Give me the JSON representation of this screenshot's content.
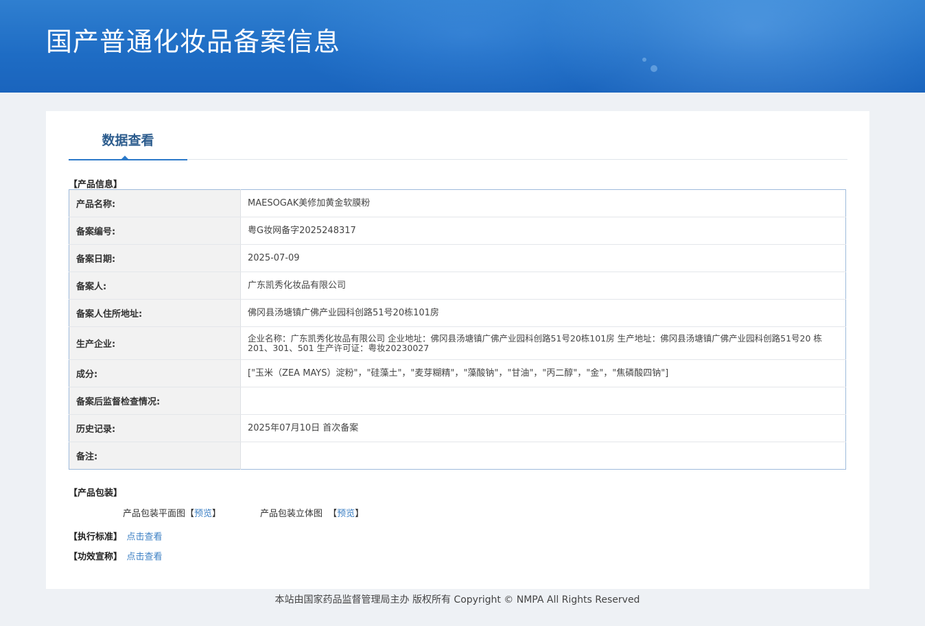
{
  "header": {
    "title": "国产普通化妆品备案信息"
  },
  "tabs": [
    {
      "label": "数据查看"
    }
  ],
  "product_info": {
    "section_title": "【产品信息】",
    "rows": [
      {
        "label": "产品名称:",
        "value": "MAESOGAK美修加黄金软膜粉"
      },
      {
        "label": "备案编号:",
        "value": "粤G妆网备字2025248317"
      },
      {
        "label": "备案日期:",
        "value": "2025-07-09"
      },
      {
        "label": "备案人:",
        "value": "广东凯秀化妆品有限公司"
      },
      {
        "label": "备案人住所地址:",
        "value": "佛冈县汤塘镇广佛产业园科创路51号20栋101房"
      },
      {
        "label": "生产企业:",
        "value": "企业名称：广东凯秀化妆品有限公司 企业地址：佛冈县汤塘镇广佛产业园科创路51号20栋101房 生产地址：佛冈县汤塘镇广佛产业园科创路51号20 栋201、301、501 生产许可证：粤妆20230027"
      },
      {
        "label": "成分:",
        "value": "[\"玉米（ZEA MAYS）淀粉\"，\"硅藻土\"，\"麦芽糊精\"，\"藻酸钠\"，\"甘油\"，\"丙二醇\"，\"金\"，\"焦磷酸四钠\"]"
      },
      {
        "label": "备案后监督检查情况:",
        "value": ""
      },
      {
        "label": "历史记录:",
        "value": "2025年07月10日 首次备案"
      },
      {
        "label": "备注:",
        "value": ""
      }
    ]
  },
  "packaging": {
    "section_title": "【产品包装】",
    "flat_label": "产品包装平面图",
    "solid_label": "产品包装立体图",
    "bracket_open": "【",
    "bracket_close": "】",
    "preview_label": "预览"
  },
  "standard": {
    "section_title": "【执行标准】",
    "link_label": "点击查看"
  },
  "efficacy": {
    "section_title": "【功效宣称】",
    "link_label": "点击查看"
  },
  "footer": {
    "text": "本站由国家药品监督管理局主办 版权所有 Copyright © NMPA All Rights Reserved"
  },
  "colors": {
    "banner": "#1e6cc4",
    "accent": "#2b79c9",
    "link": "#3b7fc4",
    "tab_text": "#2d5d8e"
  }
}
